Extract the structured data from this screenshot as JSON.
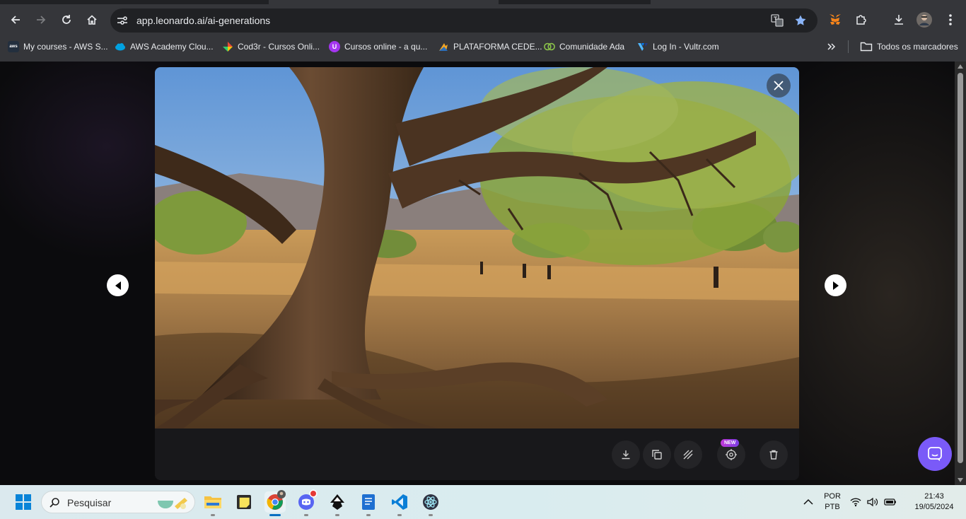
{
  "browser": {
    "url": "app.leonardo.ai/ai-generations",
    "bookmarks": [
      {
        "label": "My courses - AWS S...",
        "icon": "aws-icon"
      },
      {
        "label": "AWS Academy Clou...",
        "icon": "salesforce-cloud-icon"
      },
      {
        "label": "Cod3r - Cursos Onli...",
        "icon": "cod3r-icon"
      },
      {
        "label": "Cursos online - a qu...",
        "icon": "udemy-icon"
      },
      {
        "label": "PLATAFORMA CEDE...",
        "icon": "cedem-icon"
      },
      {
        "label": "Comunidade Ada",
        "icon": "ada-icon"
      },
      {
        "label": "Log In - Vultr.com",
        "icon": "vultr-icon"
      }
    ],
    "all_bookmarks_label": "Todos os marcadores"
  },
  "viewer": {
    "image_alt": "Generated image: large twisted tree with exposed roots in a sunny desert landscape",
    "new_badge": "NEW",
    "actions": [
      "download-icon",
      "copy-icon",
      "remove-background-icon",
      "motion-icon",
      "trash-icon"
    ]
  },
  "taskbar": {
    "search_placeholder": "Pesquisar",
    "language_top": "POR",
    "language_bottom": "PTB",
    "time": "21:43",
    "date": "19/05/2024"
  },
  "colors": {
    "chrome_bg": "#35363a",
    "omnibox_bg": "#202124",
    "modal_bg": "#18181b",
    "chat_launcher": "#7a5af8",
    "star": "#8ab4f8"
  }
}
